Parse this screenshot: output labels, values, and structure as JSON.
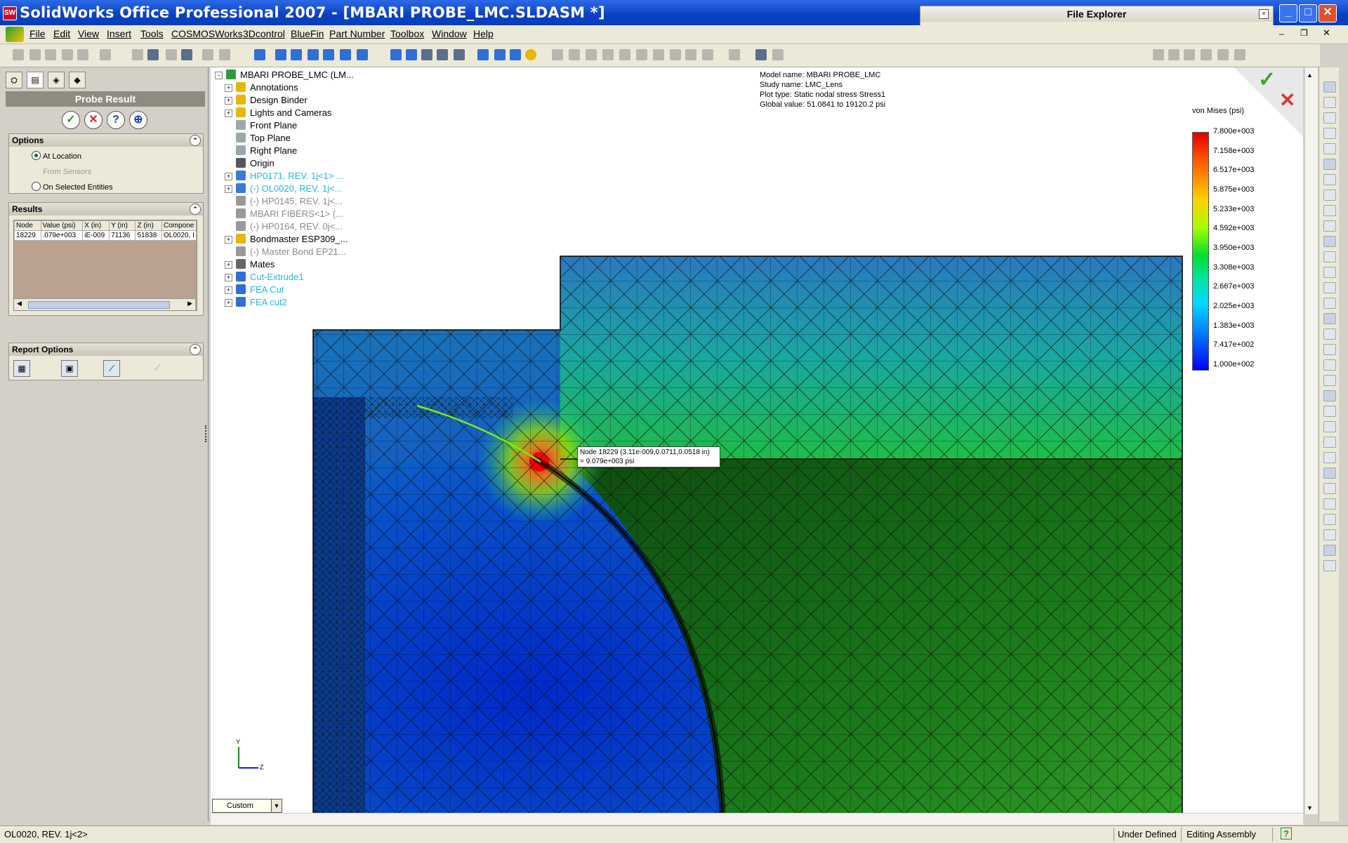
{
  "window": {
    "title": "SolidWorks Office Professional 2007 - [MBARI PROBE_LMC.SLDASM *]",
    "app_icon": "SW"
  },
  "menu": [
    "File",
    "Edit",
    "View",
    "Insert",
    "Tools",
    "COSMOSWorks",
    "3Dcontrol",
    "BlueFin",
    "Part Number",
    "Toolbox",
    "Window",
    "Help"
  ],
  "file_explorer": {
    "title": "File Explorer"
  },
  "probe_panel": {
    "header": "Probe Result",
    "options": {
      "title": "Options",
      "items": [
        {
          "label": "At Location",
          "selected": true,
          "enabled": true
        },
        {
          "label": "From Sensors",
          "selected": false,
          "enabled": false
        },
        {
          "label": "On Selected Entities",
          "selected": false,
          "enabled": true
        }
      ]
    },
    "results": {
      "title": "Results",
      "columns": [
        "Node",
        "Value (psi)",
        "X (in)",
        "Y (in)",
        "Z (in)",
        "Compone"
      ],
      "rows": [
        [
          "18229",
          ".079e+003",
          "iE-009",
          "71136",
          "51838",
          "OL0020, I"
        ]
      ]
    },
    "report": {
      "title": "Report Options"
    }
  },
  "tree": [
    {
      "label": "MBARI PROBE_LMC  (LM...",
      "color": "#000000",
      "expander": "-"
    },
    {
      "label": "Annotations",
      "color": "#000000",
      "expander": "+"
    },
    {
      "label": "Design Binder",
      "color": "#000000",
      "expander": "+"
    },
    {
      "label": "Lights and Cameras",
      "color": "#000000",
      "expander": "+"
    },
    {
      "label": "Front Plane",
      "color": "#000000",
      "expander": ""
    },
    {
      "label": "Top Plane",
      "color": "#000000",
      "expander": ""
    },
    {
      "label": "Right Plane",
      "color": "#000000",
      "expander": ""
    },
    {
      "label": "Origin",
      "color": "#000000",
      "expander": ""
    },
    {
      "label": "HP0171, REV. 1j<1> ...",
      "color": "#1fb8e0",
      "expander": "+"
    },
    {
      "label": "(-) OL0020, REV. 1j<...",
      "color": "#1fb8e0",
      "expander": "+"
    },
    {
      "label": "(-) HP0145, REV. 1j<...",
      "color": "#8a8a8a",
      "expander": ""
    },
    {
      "label": "MBARI FIBERS<1> (...",
      "color": "#8a8a8a",
      "expander": ""
    },
    {
      "label": "(-) HP0164, REV. 0j<...",
      "color": "#8a8a8a",
      "expander": ""
    },
    {
      "label": "Bondmaster ESP309_...",
      "color": "#000000",
      "expander": "+"
    },
    {
      "label": "(-) Master Bond EP21...",
      "color": "#8a8a8a",
      "expander": ""
    },
    {
      "label": "Mates",
      "color": "#000000",
      "expander": "+"
    },
    {
      "label": "Cut-Extrude1",
      "color": "#1fb8e0",
      "expander": "+"
    },
    {
      "label": "FEA Cut",
      "color": "#1fb8e0",
      "expander": "+"
    },
    {
      "label": "FEA cut2",
      "color": "#1fb8e0",
      "expander": "+"
    }
  ],
  "study_info": {
    "model": "Model name: MBARI PROBE_LMC",
    "study": "Study name: LMC_Lens",
    "plot": "Plot type: Static nodal stress Stress1",
    "global": "Global value: 51.0841 to 19120.2 psi"
  },
  "legend": {
    "title": "von Mises (psi)",
    "labels": [
      "7.800e+003",
      "7.158e+003",
      "6.517e+003",
      "5.875e+003",
      "5.233e+003",
      "4.592e+003",
      "3.950e+003",
      "3.308e+003",
      "2.667e+003",
      "2.025e+003",
      "1.383e+003",
      "7.417e+002",
      "1.000e+002"
    ]
  },
  "probe_tooltip": {
    "line1": "Node 18229 (3.11e-009,0.0711,0.0518 in)",
    "line2": " = 9.079e+003 psi"
  },
  "triad": {
    "y": "Y",
    "z": "Z"
  },
  "view_combo": "Custom",
  "status": {
    "left": "OL0020, REV. 1j<2>",
    "state": "Under Defined",
    "mode": "Editing Assembly",
    "help": "?"
  }
}
